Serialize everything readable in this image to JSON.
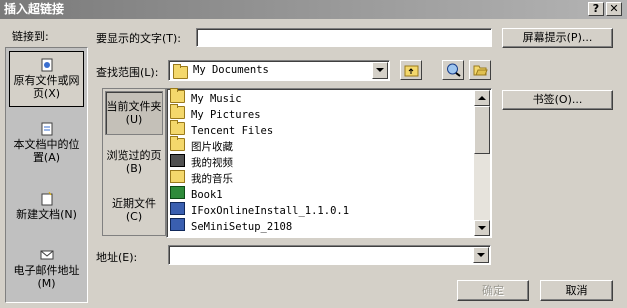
{
  "window": {
    "title": "插入超链接",
    "help_glyph": "?",
    "close_glyph": "✕"
  },
  "link_to": {
    "label": "链接到:",
    "items": [
      {
        "label": "原有文件或网页(X)",
        "icon": "globe-page-icon",
        "selected": true
      },
      {
        "label": "本文档中的位置(A)",
        "icon": "document-place-icon",
        "selected": false
      },
      {
        "label": "新建文档(N)",
        "icon": "new-document-icon",
        "selected": false
      },
      {
        "label": "电子邮件地址(M)",
        "icon": "email-icon",
        "selected": false
      }
    ]
  },
  "display_text": {
    "label": "要显示的文字(T):",
    "value": ""
  },
  "screen_tip_button": "屏幕提示(P)...",
  "look_in": {
    "label": "查找范围(L):",
    "value": "My Documents"
  },
  "bookmark_button": "书签(O)...",
  "views": [
    {
      "label": "当前文件夹(U)",
      "selected": true
    },
    {
      "label": "浏览过的页(B)",
      "selected": false
    },
    {
      "label": "近期文件(C)",
      "selected": false
    }
  ],
  "files": [
    {
      "name": "My Music",
      "icon": "folder-icon"
    },
    {
      "name": "My Pictures",
      "icon": "folder-icon"
    },
    {
      "name": "Tencent Files",
      "icon": "folder-icon"
    },
    {
      "name": "图片收藏",
      "icon": "folder-icon"
    },
    {
      "name": "我的视频",
      "icon": "video-folder-icon"
    },
    {
      "name": "我的音乐",
      "icon": "music-folder-icon"
    },
    {
      "name": "Book1",
      "icon": "excel-file-icon"
    },
    {
      "name": "IFoxOnlineInstall_1.1.0.1",
      "icon": "installer-icon"
    },
    {
      "name": "SeMiniSetup_2108",
      "icon": "installer-icon"
    }
  ],
  "address": {
    "label": "地址(E):",
    "value": ""
  },
  "ok_button": "确定",
  "cancel_button": "取消"
}
